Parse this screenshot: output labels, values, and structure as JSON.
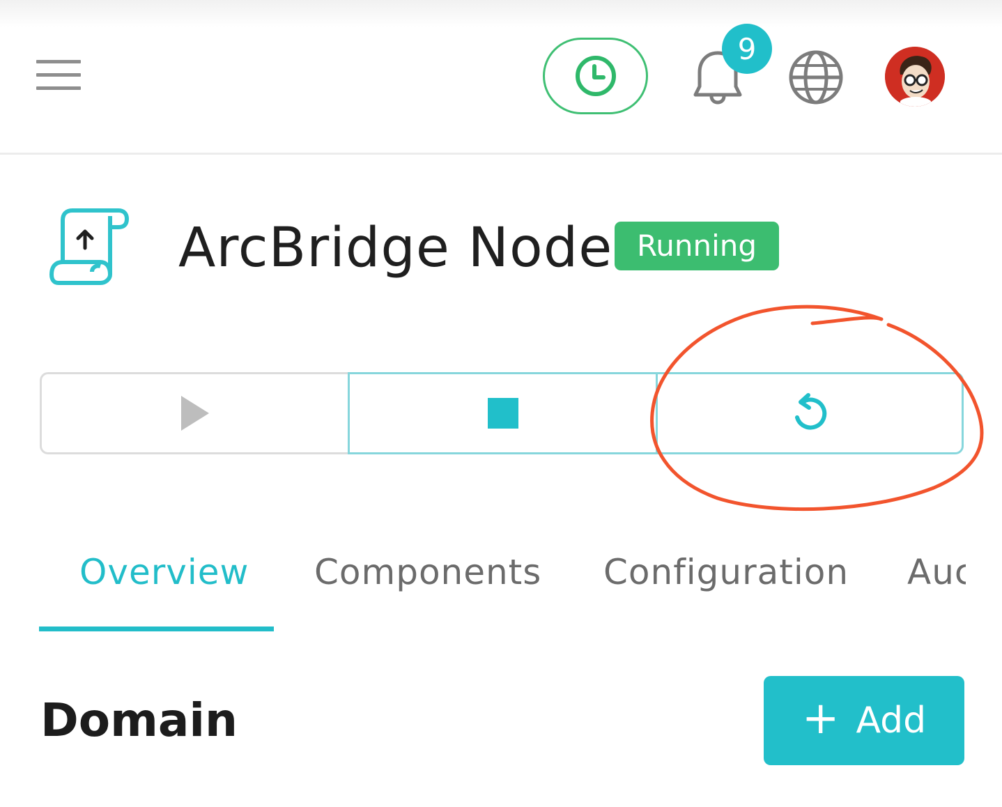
{
  "header": {
    "menu_icon": "hamburger-menu-icon",
    "clock_icon": "clock-icon",
    "notifications": {
      "icon": "bell-icon",
      "count": "9"
    },
    "language_icon": "globe-icon",
    "avatar_icon": "user-avatar"
  },
  "node": {
    "icon": "scroll-upload-icon",
    "name": "ArcBridge Node",
    "status": "Running"
  },
  "actions": {
    "start_icon": "play-icon",
    "stop_icon": "stop-icon",
    "restart_icon": "restart-icon"
  },
  "tabs": [
    {
      "label": "Overview",
      "active": true
    },
    {
      "label": "Components",
      "active": false
    },
    {
      "label": "Configuration",
      "active": false
    },
    {
      "label": "Auc",
      "active": false
    }
  ],
  "section": {
    "title": "Domain",
    "add_label": "Add"
  },
  "colors": {
    "accent": "#22bdc9",
    "status_green": "#3cbd70",
    "annotation": "#f2542d"
  }
}
